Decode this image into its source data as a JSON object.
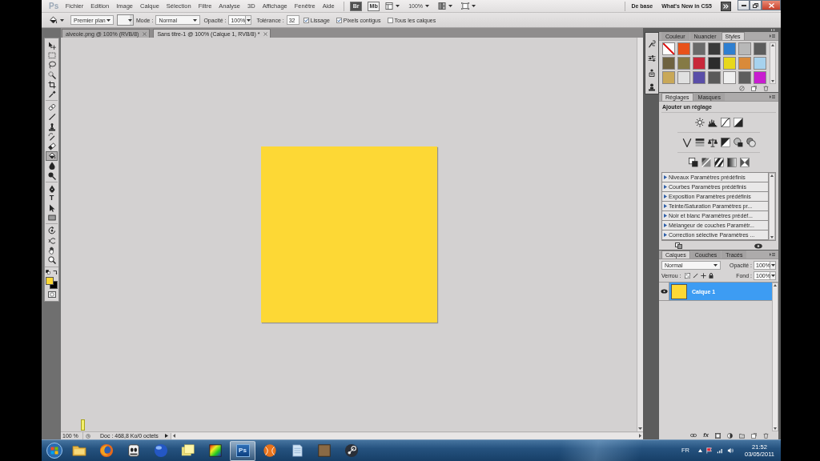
{
  "menu_bar": {
    "logo": "Ps",
    "menus": [
      "Fichier",
      "Edition",
      "Image",
      "Calque",
      "Sélection",
      "Filtre",
      "Analyse",
      "3D",
      "Affichage",
      "Fenêtre",
      "Aide"
    ],
    "launchers": [
      "Br",
      "Mb"
    ],
    "zoom": "100%",
    "workspaces": [
      "De base",
      "What's New in CS5"
    ]
  },
  "options_bar": {
    "fill_source": "Premier plan",
    "mode_label": "Mode :",
    "mode": "Normal",
    "opacity_label": "Opacité :",
    "opacity": "100%",
    "tolerance_label": "Tolérance :",
    "tolerance": "32",
    "checkboxes": [
      {
        "label": "Lissage",
        "checked": true
      },
      {
        "label": "Pixels contigus",
        "checked": true
      },
      {
        "label": "Tous les calques",
        "checked": false
      }
    ]
  },
  "document_tabs": [
    {
      "label": "alveole.png @ 100% (RVB/8)",
      "selected": false
    },
    {
      "label": "Sans titre-1 @ 100% (Calque 1, RVB/8) *",
      "selected": true
    }
  ],
  "toolbox": {
    "groups": [
      {
        "tools": [
          {
            "kind": "move",
            "selected": false
          },
          {
            "kind": "marquee",
            "selected": false
          },
          {
            "kind": "lasso",
            "selected": false
          },
          {
            "kind": "wand",
            "selected": false
          },
          {
            "kind": "crop",
            "selected": false
          },
          {
            "kind": "eyedropper",
            "selected": false
          }
        ]
      },
      {
        "tools": [
          {
            "kind": "healing",
            "selected": false
          },
          {
            "kind": "brush",
            "selected": false
          },
          {
            "kind": "stamp",
            "selected": false
          },
          {
            "kind": "history-brush",
            "selected": false
          },
          {
            "kind": "eraser",
            "selected": false
          },
          {
            "kind": "bucket",
            "selected": true
          },
          {
            "kind": "blur",
            "selected": false
          },
          {
            "kind": "dodge",
            "selected": false
          }
        ]
      },
      {
        "tools": [
          {
            "kind": "pen",
            "selected": false
          },
          {
            "kind": "type",
            "glyph": "T",
            "selected": false
          },
          {
            "kind": "path-select",
            "selected": false
          },
          {
            "kind": "shape",
            "selected": false
          }
        ]
      },
      {
        "tools": [
          {
            "kind": "rotate-3d",
            "selected": false
          },
          {
            "kind": "orbit-3d",
            "selected": false
          },
          {
            "kind": "hand",
            "selected": false
          },
          {
            "kind": "zoom",
            "selected": false
          }
        ]
      }
    ]
  },
  "status_bar": {
    "zoom": "100 %",
    "info": "Doc : 468,8 Ko/0 octets"
  },
  "styles_panel": {
    "tabs": [
      {
        "label": "Couleur",
        "selected": false
      },
      {
        "label": "Nuancier",
        "selected": false
      },
      {
        "label": "Styles",
        "selected": true
      }
    ],
    "swatches": [
      {
        "kind": "none",
        "color": "#ffffff"
      },
      {
        "kind": "plain",
        "color": "#e8521a"
      },
      {
        "kind": "plain",
        "color": "#6a6a6a"
      },
      {
        "kind": "plain",
        "color": "#3a3a3a"
      },
      {
        "kind": "plain",
        "color": "#2f7fd0"
      },
      {
        "kind": "plain",
        "color": "#b8b8b8"
      },
      {
        "kind": "plain",
        "color": "#5c5c5c"
      },
      {
        "kind": "plain",
        "color": "#6e6240"
      },
      {
        "kind": "plain",
        "color": "#857a45"
      },
      {
        "kind": "plain",
        "color": "#c8283a"
      },
      {
        "kind": "plain",
        "color": "#2c2c2c"
      },
      {
        "kind": "plain",
        "color": "#e8d81c"
      },
      {
        "kind": "plain",
        "color": "#d98a3a"
      },
      {
        "kind": "plain",
        "color": "#a6d2ee"
      },
      {
        "kind": "plain",
        "color": "#c9a858"
      },
      {
        "kind": "plain",
        "color": "#e0e0e0"
      },
      {
        "kind": "plain",
        "color": "#5a4ea8"
      },
      {
        "kind": "plain",
        "color": "#5a5a5a"
      },
      {
        "kind": "plain",
        "color": "#efefef"
      },
      {
        "kind": "plain",
        "color": "#5e5e5e"
      },
      {
        "kind": "plain",
        "color": "#c81ed0"
      }
    ]
  },
  "adjustments_panel": {
    "tabs": [
      {
        "label": "Réglages",
        "selected": true
      },
      {
        "label": "Masques",
        "selected": false
      }
    ],
    "title": "Ajouter un réglage",
    "presets": [
      {
        "label": "Niveaux Paramètres prédéfinis",
        "expanded": false
      },
      {
        "label": "Courbes Paramètres prédéfinis",
        "expanded": false
      },
      {
        "label": "Exposition Paramètres prédéfinis",
        "expanded": false
      },
      {
        "label": "Teinte/Saturation Paramètres pr...",
        "expanded": false
      },
      {
        "label": "Noir et blanc Paramètres prédéf...",
        "expanded": false
      },
      {
        "label": "Mélangeur de couches Paramètr...",
        "expanded": false
      },
      {
        "label": "Correction sélective Paramètres ...",
        "expanded": false
      }
    ]
  },
  "layers_panel": {
    "tabs": [
      {
        "label": "Calques",
        "selected": true
      },
      {
        "label": "Couches",
        "selected": false
      },
      {
        "label": "Tracés",
        "selected": false
      }
    ],
    "blend_mode": "Normal",
    "opacity_label": "Opacité :",
    "opacity": "100%",
    "lock_label": "Verrou :",
    "fill_label": "Fond :",
    "fill": "100%",
    "layers": [
      {
        "name": "Calque 1",
        "visible": true,
        "selected": true
      }
    ],
    "fx_label": "fx"
  },
  "taskbar": {
    "apps": [
      {
        "kind": "folder",
        "selected": false
      },
      {
        "kind": "fox-globe",
        "selected": false
      },
      {
        "kind": "cartoon",
        "selected": false
      },
      {
        "kind": "sphere",
        "selected": false
      },
      {
        "kind": "notes",
        "selected": false
      },
      {
        "kind": "rainbow",
        "selected": false
      },
      {
        "kind": "tile",
        "label": "Ps",
        "selected": true
      },
      {
        "kind": "ball",
        "selected": false
      },
      {
        "kind": "notepad",
        "selected": false
      },
      {
        "kind": "picture",
        "selected": false
      },
      {
        "kind": "piston",
        "selected": false
      }
    ],
    "language": "FR",
    "time": "21:52",
    "date": "03/05/2011"
  }
}
